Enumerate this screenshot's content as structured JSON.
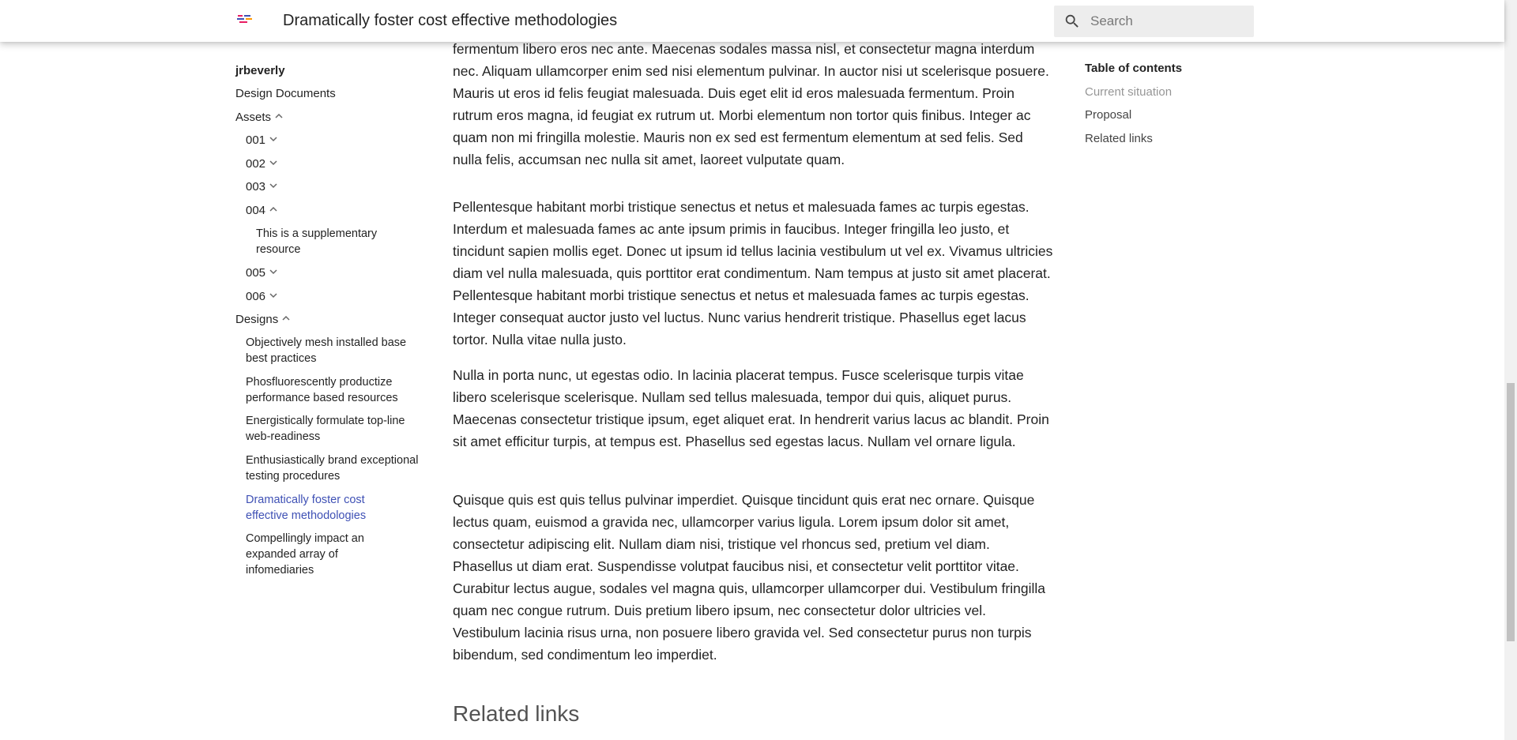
{
  "header": {
    "title": "Dramatically foster cost effective methodologies",
    "search_placeholder": "Search",
    "logo_colors": [
      "#e91e63",
      "#3f51b5",
      "#ff9800"
    ]
  },
  "nav": {
    "site_name": "jrbeverly",
    "items": {
      "design_documents": "Design Documents",
      "assets": "Assets",
      "a001": "001",
      "a002": "002",
      "a003": "003",
      "a004": "004",
      "supplementary": "This is a supplementary resource",
      "a005": "005",
      "a006": "006",
      "designs": "Designs",
      "d1": "Objectively mesh installed base best practices",
      "d2": "Phosfluorescently productize performance based resources",
      "d3": "Energistically formulate top-line web-readiness",
      "d4": "Enthusiastically brand exceptional testing procedures",
      "d5": "Dramatically foster cost effective methodologies",
      "d6": "Compellingly impact an expanded array of infomediaries"
    },
    "active_color": "#3f51b5"
  },
  "content": {
    "p0": "Nunc pharetra dui vel lectus egestas, eget ullamcorper lectus dictum. Maecenas fermentum fringilla sodales. Praesent mollis magna quis condimentum efficitur, nisl mi consequat urna, eu fermentum libero eros nec ante. Maecenas sodales massa nisl, et consectetur magna interdum nec. Aliquam ullamcorper enim sed nisi elementum pulvinar. In auctor nisi ut scelerisque posuere. Mauris ut eros id felis feugiat malesuada. Duis eget elit id eros malesuada fermentum. Proin rutrum eros magna, id feugiat ex rutrum ut. Morbi elementum non tortor quis finibus. Integer ac quam non mi fringilla molestie. Mauris non ex sed est fermentum elementum at sed felis. Sed nulla felis, accumsan nec nulla sit amet, laoreet vulputate quam.",
    "p1": "Pellentesque habitant morbi tristique senectus et netus et malesuada fames ac turpis egestas. Interdum et malesuada fames ac ante ipsum primis in faucibus. Integer fringilla leo justo, et tincidunt sapien mollis eget. Donec ut ipsum id tellus lacinia vestibulum ut vel ex. Vivamus ultricies diam vel nulla malesuada, quis porttitor erat condimentum. Nam tempus at justo sit amet placerat. Pellentesque habitant morbi tristique senectus et netus et malesuada fames ac turpis egestas. Integer consequat auctor justo vel luctus. Nunc varius hendrerit tristique. Phasellus eget lacus tortor. Nulla vitae nulla justo.",
    "p2": "Nulla in porta nunc, ut egestas odio. In lacinia placerat tempus. Fusce scelerisque turpis vitae libero scelerisque scelerisque. Nullam sed tellus malesuada, tempor dui quis, aliquet purus. Maecenas consectetur tristique ipsum, eget aliquet erat. In hendrerit varius lacus ac blandit. Proin sit amet efficitur turpis, at tempus est. Phasellus sed egestas lacus. Nullam vel ornare ligula.",
    "p3": "Quisque quis est quis tellus pulvinar imperdiet. Quisque tincidunt quis erat nec ornare. Quisque lectus quam, euismod a gravida nec, ullamcorper varius ligula. Lorem ipsum dolor sit amet, consectetur adipiscing elit. Nullam diam nisi, tristique vel rhoncus sed, pretium vel diam. Phasellus ut diam erat. Suspendisse volutpat faucibus nisi, et consectetur velit porttitor vitae. Curabitur lectus augue, sodales vel magna quis, ullamcorper ullamcorper dui. Vestibulum fringilla quam nec congue rutrum. Duis pretium libero ipsum, nec consectetur dolor ultricies vel. Vestibulum lacinia risus urna, non posuere libero gravida vel. Sed consectetur purus non turpis bibendum, sed condimentum leo imperdiet.",
    "related_heading": "Related links"
  },
  "toc": {
    "title": "Table of contents",
    "links": {
      "current": "Current situation",
      "proposal": "Proposal",
      "related": "Related links"
    }
  }
}
